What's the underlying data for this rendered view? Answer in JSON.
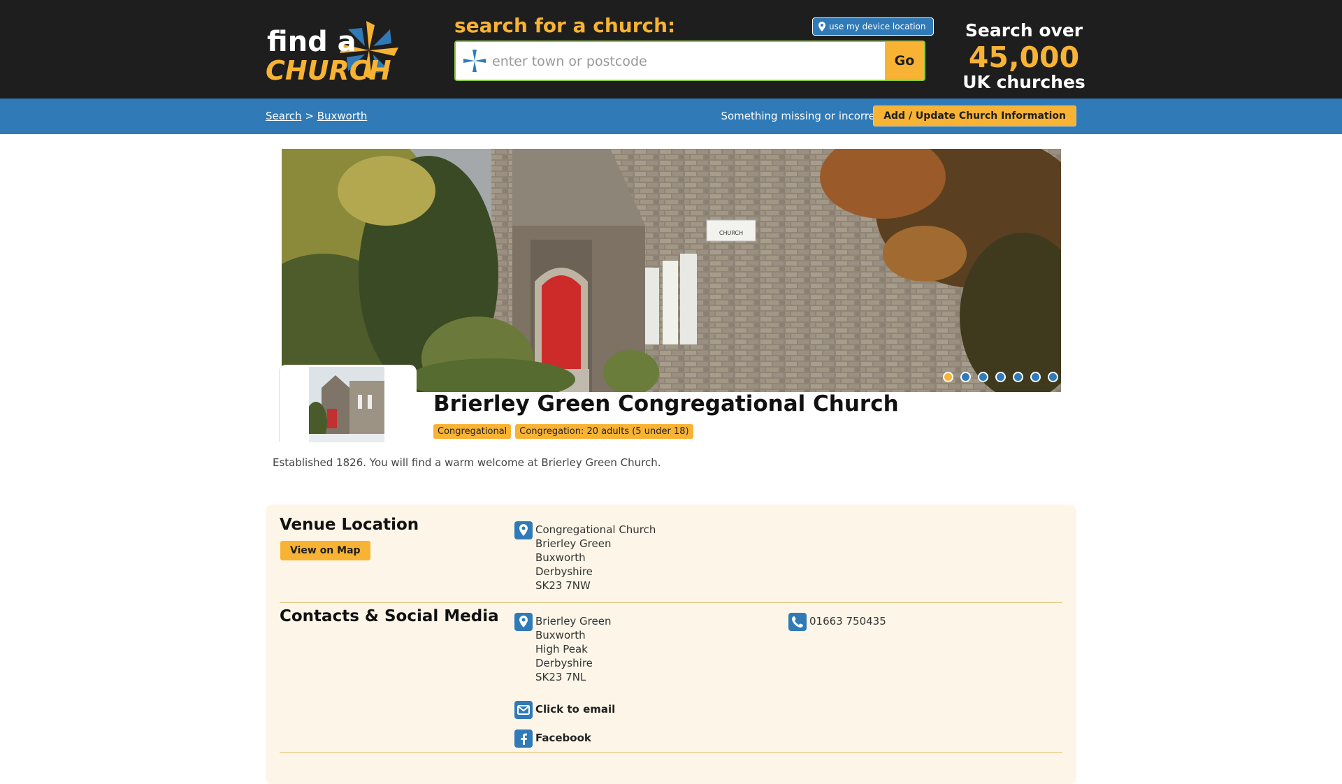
{
  "header": {
    "logo_line1": "find a",
    "logo_line2": "CHURCH",
    "search_label": "search for a church:",
    "location_button": "use my device location",
    "search_placeholder": "enter town or postcode",
    "go_label": "Go",
    "stats_line1": "Search over",
    "stats_count": "45,000",
    "stats_line3": "UK churches"
  },
  "nav": {
    "breadcrumb": [
      {
        "label": "Search"
      },
      {
        "label": "Buxworth"
      }
    ],
    "separator": ">",
    "missing_text": "Something missing or incorrect?",
    "update_button": "Add / Update Church Information"
  },
  "church": {
    "name": "Brierley Green Congregational Church",
    "badges": [
      "Congregational",
      "Congregation: 20 adults (5 under 18)"
    ],
    "description": "Established 1826. You will find a warm welcome at Brierley Green Church.",
    "sign_text": "CHURCH"
  },
  "carousel": {
    "slide_count": 7,
    "active_index": 0
  },
  "venue": {
    "title": "Venue Location",
    "map_button": "View on Map",
    "address": [
      "Congregational Church",
      "Brierley Green",
      "Buxworth",
      "Derbyshire",
      "SK23 7NW"
    ]
  },
  "contacts": {
    "title": "Contacts & Social Media",
    "address": [
      "Brierley Green",
      "Buxworth",
      "High Peak",
      "Derbyshire",
      "SK23 7NL"
    ],
    "phone": "01663 750435",
    "email_label": "Click to email",
    "facebook_label": "Facebook"
  },
  "colors": {
    "accent": "#f8b334",
    "brand_blue": "#2f7ab7",
    "header_bg": "#1e1e1e",
    "panel_bg": "#fdf6e8"
  }
}
